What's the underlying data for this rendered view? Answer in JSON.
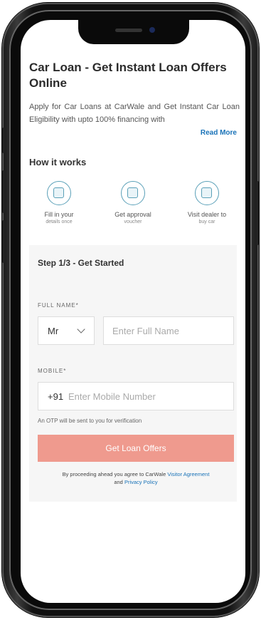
{
  "page": {
    "title": "Car Loan - Get Instant Loan Offers Online",
    "description": "Apply for Car Loans at CarWale and Get Instant Car Loan Eligibility with upto 100% financing with",
    "read_more": "Read More"
  },
  "how_it_works": {
    "heading": "How it works",
    "steps": [
      {
        "title": "Fill in your",
        "subtitle": "details once",
        "icon": "form-icon"
      },
      {
        "title": "Get approval",
        "subtitle": "voucher",
        "icon": "voucher-icon"
      },
      {
        "title": "Visit dealer to",
        "subtitle": "buy car",
        "icon": "car-dealer-icon"
      }
    ]
  },
  "form": {
    "step_heading": "Step 1/3 - Get Started",
    "full_name_label": "FULL NAME*",
    "salutation": "Mr",
    "full_name_placeholder": "Enter Full Name",
    "mobile_label": "MOBILE*",
    "country_code": "+91",
    "mobile_placeholder": "Enter Mobile Number",
    "otp_note": "An OTP will be sent to you for verification",
    "submit_label": "Get Loan Offers",
    "agree_prefix": "By proceeding ahead you agree to CarWale",
    "agree_link_1": "Visitor Agreement",
    "agree_and": "and",
    "agree_link_2": "Privacy Policy"
  },
  "colors": {
    "accent_link": "#1a73b8",
    "cta_bg": "#ef9a8e",
    "icon_stroke": "#5aa0b8"
  }
}
